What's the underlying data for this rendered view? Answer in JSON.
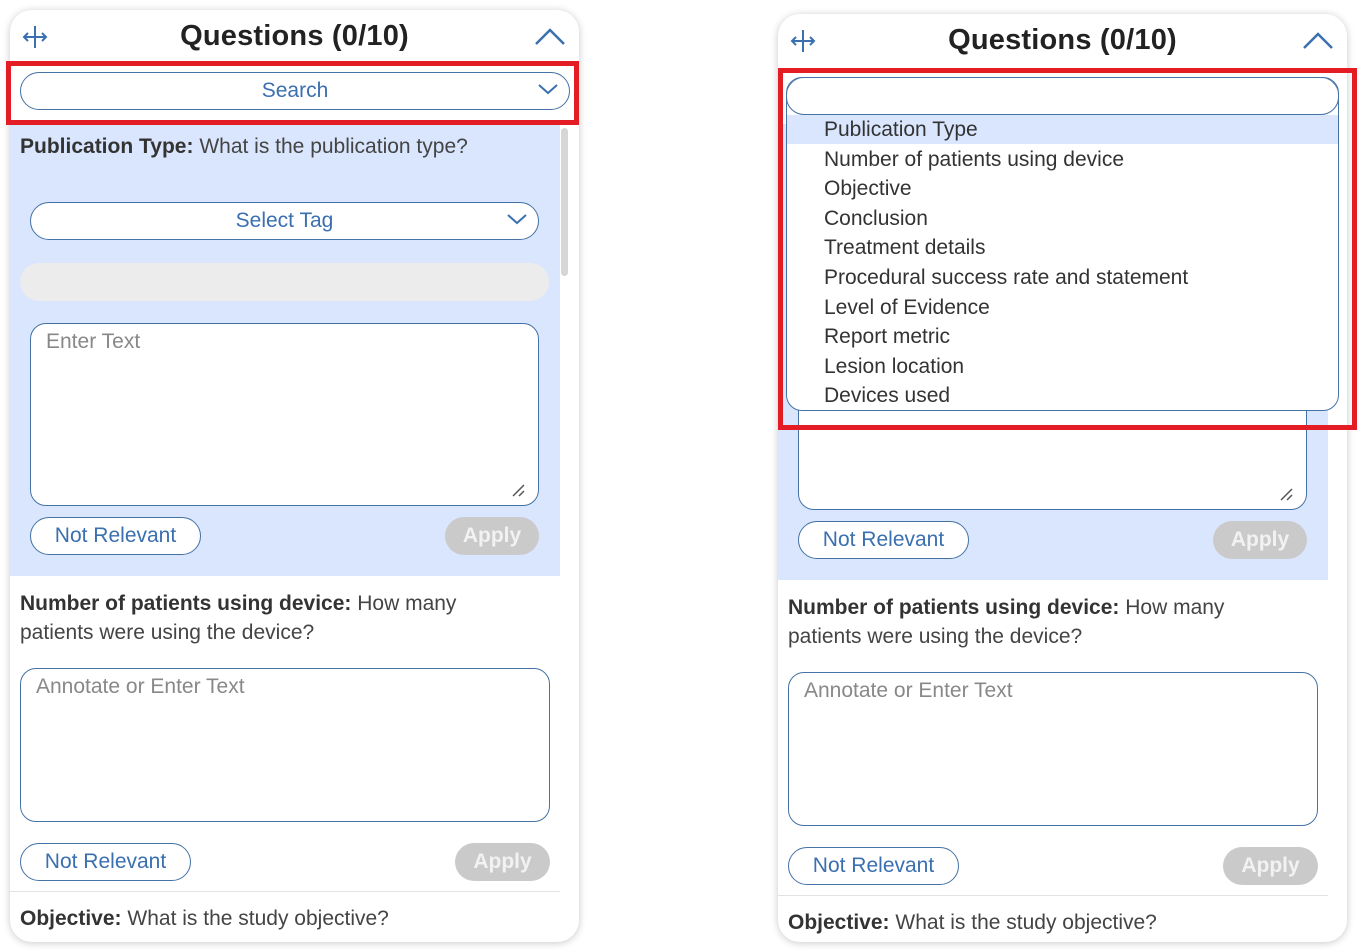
{
  "panel_title": "Questions (0/10)",
  "search_placeholder": "Search",
  "q1": {
    "label": "Publication Type:",
    "text": "What is the publication type?",
    "tag_select": "Select Tag",
    "text_placeholder": "Enter Text",
    "not_relevant": "Not Relevant",
    "apply": "Apply"
  },
  "q2": {
    "label": "Number of patients using device:",
    "text_line1": "How many",
    "text_line2": "patients were using the device?",
    "text_placeholder": "Annotate or Enter Text",
    "not_relevant": "Not Relevant",
    "apply": "Apply"
  },
  "q3": {
    "label": "Objective:",
    "text": "What is the study objective?"
  },
  "dropdown_options": [
    "Publication Type",
    "Number of patients using device",
    "Objective",
    "Conclusion",
    "Treatment details",
    "Procedural success rate and statement",
    "Level of Evidence",
    "Report metric",
    "Lesion location",
    "Devices used"
  ],
  "dropdown_highlighted_index": 0,
  "colors": {
    "accent": "#3a6fb0",
    "highlight_bg": "#d9e6fd",
    "callout": "#e41c24",
    "apply_disabled": "#cacaca"
  }
}
